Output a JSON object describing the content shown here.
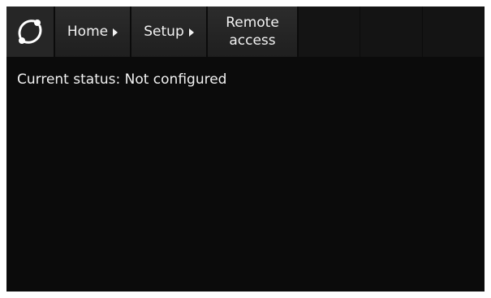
{
  "breadcrumb": {
    "home_label": "Home",
    "setup_label": "Setup",
    "current_line1": "Remote",
    "current_line2": "access"
  },
  "status": {
    "label": "Current status:",
    "value": "Not configured"
  },
  "icons": {
    "logo": "circular-arrows-logo-icon",
    "breadcrumb_separator": "triangle-right-icon"
  },
  "colors": {
    "background": "#0b0b0b",
    "topbar_tab": "#262626",
    "text": "#f2f2f2"
  }
}
